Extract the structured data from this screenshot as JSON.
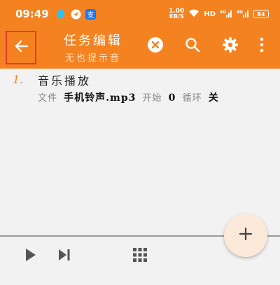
{
  "status_bar": {
    "time": "09:49",
    "net_speed_value": "1.00",
    "net_speed_unit": "KB/S",
    "hd_label": "HD",
    "sig1_label": "4G",
    "sig2_label": "4G",
    "battery": "84"
  },
  "app_bar": {
    "title": "任务编辑",
    "subtitle": "无也提示音"
  },
  "task": {
    "number": "1.",
    "title": "音乐播放",
    "file_label": "文件",
    "file_value": "手机铃声.mp3",
    "start_label": "开始",
    "start_value": "0",
    "loop_label": "循环",
    "loop_value": "关"
  },
  "colors": {
    "accent": "#f58220",
    "highlight_border": "#e8372b",
    "fab_bg": "#fbe9d9"
  }
}
